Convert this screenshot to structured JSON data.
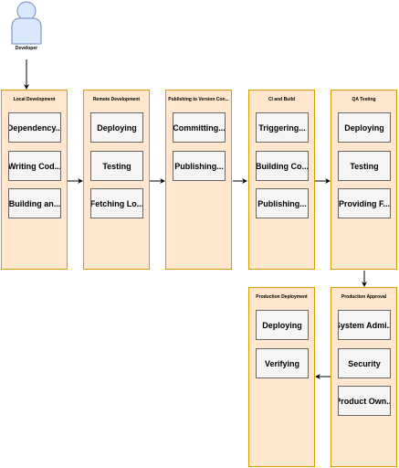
{
  "actor": {
    "label": "Developer"
  },
  "lanes": [
    {
      "title": "Local Development",
      "tasks": [
        "Dependency...",
        "Writing Cod...",
        "Building an..."
      ]
    },
    {
      "title": "Remote Development",
      "tasks": [
        "Deploying",
        "Testing",
        "Fetching Lo..."
      ]
    },
    {
      "title": "Publishing to Version Con...",
      "tasks": [
        "Committing...",
        "Publishing..."
      ]
    },
    {
      "title": "CI and Build",
      "tasks": [
        "Triggering...",
        "Building Co...",
        "Publishing..."
      ]
    },
    {
      "title": "QA Testing",
      "tasks": [
        "Deploying",
        "Testing",
        "Providing F..."
      ]
    },
    {
      "title": "Production Approval",
      "tasks": [
        "System Admi...",
        "Security",
        "Product Own..."
      ]
    },
    {
      "title": "Production Deployment",
      "tasks": [
        "Deploying",
        "Verifying"
      ]
    }
  ],
  "colors": {
    "lane_fill": "#ffe6cc",
    "lane_border": "#d79b00",
    "task_fill": "#f5f5f5",
    "actor_fill": "#dae8fc",
    "actor_border": "#6c8ebf"
  }
}
